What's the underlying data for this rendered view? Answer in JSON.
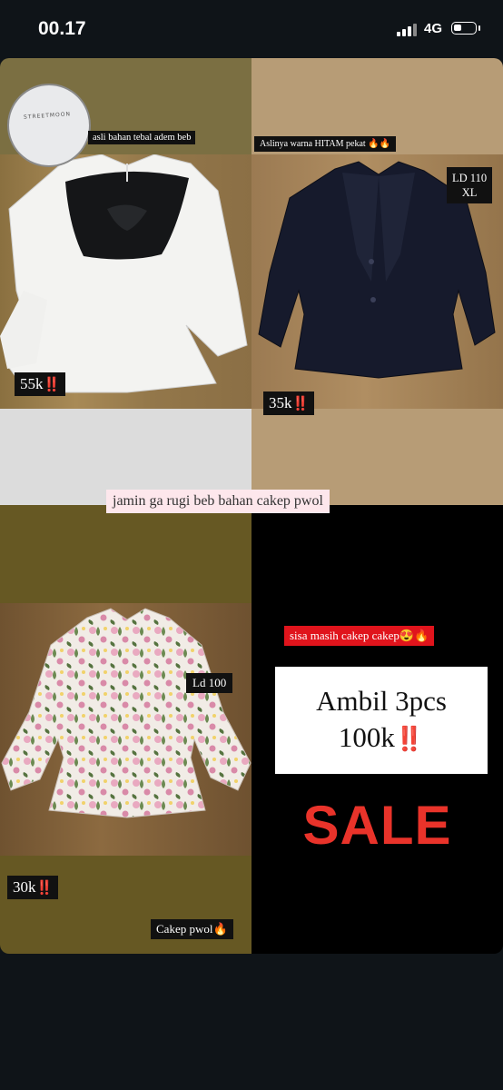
{
  "status_bar": {
    "time": "00.17",
    "network": "4G"
  },
  "story": {
    "top_left": {
      "caption": "asli bahan tebal adem beb",
      "inset_tag": "STREETMOON",
      "price": "55k",
      "price_emoji": "‼️"
    },
    "top_right": {
      "caption": "Aslinya warna HITAM pekat 🔥🔥",
      "size_ld": "LD 110",
      "size_xl": "XL",
      "price": "35k",
      "price_emoji": "‼️"
    },
    "center_banner": "jamin ga rugi beb bahan cakep pwol",
    "bottom_left": {
      "size": "Ld 100",
      "price": "30k",
      "price_emoji": "‼️",
      "label": "Cakep pwol🔥"
    },
    "bottom_right": {
      "badge": "sisa masih cakep cakep😍🔥",
      "offer_line1": "Ambil 3pcs",
      "offer_line2": "100k",
      "offer_emoji": "‼️",
      "sale": "SALE"
    }
  },
  "colors": {
    "sale_red": "#e9332a",
    "badge_red": "#e0141c",
    "banner_pink": "#fde7ec",
    "background": "#0f1418"
  },
  "icons": [
    "signal-icon",
    "battery-icon"
  ]
}
